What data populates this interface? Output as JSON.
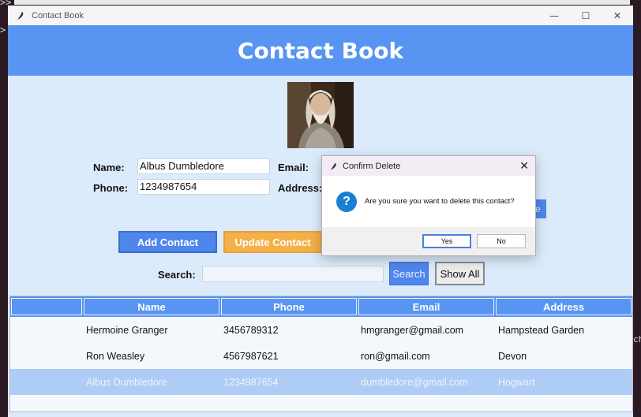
{
  "window": {
    "title": "Contact Book",
    "controls": {
      "minimize": "—",
      "maximize": "☐",
      "close": "✕"
    }
  },
  "header": {
    "title": "Contact Book"
  },
  "form": {
    "name_label": "Name:",
    "name_value": "Albus Dumbledore",
    "phone_label": "Phone:",
    "phone_value": "1234987654",
    "email_label": "Email:",
    "address_label": "Address:"
  },
  "buttons": {
    "add": "Add Contact",
    "update": "Update Contact",
    "partial": "re",
    "search": "Search",
    "show_all": "Show All"
  },
  "search": {
    "label": "Search:",
    "value": ""
  },
  "table": {
    "headers": [
      "",
      "Name",
      "Phone",
      "Email",
      "Address"
    ],
    "rows": [
      {
        "name": "Hermoine Granger",
        "phone": "3456789312",
        "email": "hmgranger@gmail.com",
        "address": "Hampstead Garden",
        "selected": false
      },
      {
        "name": "Ron Weasley",
        "phone": "4567987621",
        "email": "ron@gmail.com",
        "address": "Devon",
        "selected": false
      },
      {
        "name": "Albus Dumbledore",
        "phone": "1234987654",
        "email": "dumbledore@gmail.com",
        "address": "Hogwart",
        "selected": true
      }
    ]
  },
  "dialog": {
    "title": "Confirm Delete",
    "close": "✕",
    "icon": "?",
    "message": "Are you sure you want to delete this contact?",
    "yes": "Yes",
    "no": "No"
  },
  "background": {
    "prompt_top": ">>",
    "prompt_side": ">",
    "right_text": "ch"
  },
  "colors": {
    "header": "#5894f2",
    "accent_blue": "#4f86ec",
    "update_orange": "#f5b048",
    "selected_row": "#aeccf5",
    "window_bg": "#dcebfb"
  }
}
